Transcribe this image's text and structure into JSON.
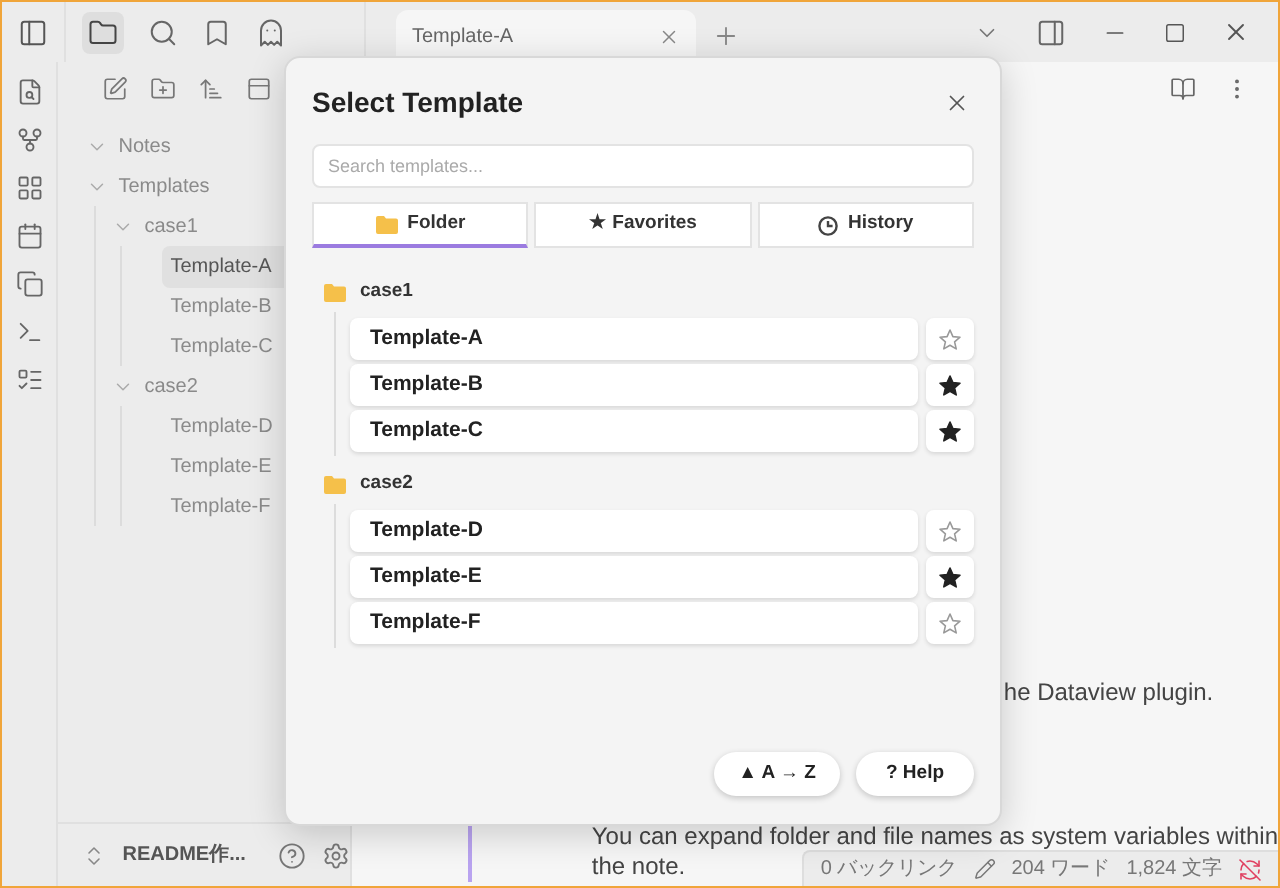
{
  "tab": {
    "title": "Template-A"
  },
  "sidebar": {
    "tree": [
      {
        "label": "Notes",
        "expanded": true,
        "selected": false
      },
      {
        "label": "Templates",
        "expanded": true,
        "selected": false,
        "children": [
          {
            "label": "case1",
            "expanded": true,
            "selected": false,
            "children": [
              {
                "label": "Template-A",
                "selected": true
              },
              {
                "label": "Template-B",
                "selected": false
              },
              {
                "label": "Template-C",
                "selected": false
              }
            ]
          },
          {
            "label": "case2",
            "expanded": true,
            "selected": false,
            "children": [
              {
                "label": "Template-D",
                "selected": false
              },
              {
                "label": "Template-E",
                "selected": false
              },
              {
                "label": "Template-F",
                "selected": false
              }
            ]
          }
        ]
      }
    ],
    "vault": "README作..."
  },
  "editor": {
    "partial_line": "he Dataview plugin.",
    "paragraph_lines": [
      "You can expand folder and file names as system variables within",
      "the note."
    ]
  },
  "status_bar": {
    "backlinks": "0 バックリンク",
    "words": "204 ワード",
    "chars": "1,824 文字"
  },
  "modal": {
    "title": "Select Template",
    "search": {
      "placeholder": "Search templates..."
    },
    "tabs": [
      {
        "label": "Folder",
        "selected": true
      },
      {
        "label": "★ Favorites",
        "selected": false
      },
      {
        "label": "History",
        "selected": false
      }
    ],
    "groups": [
      {
        "name": "case1",
        "templates": [
          {
            "name": "Template-A",
            "favorite": false
          },
          {
            "name": "Template-B",
            "favorite": true
          },
          {
            "name": "Template-C",
            "favorite": true
          }
        ]
      },
      {
        "name": "case2",
        "templates": [
          {
            "name": "Template-D",
            "favorite": false
          },
          {
            "name": "Template-E",
            "favorite": true
          },
          {
            "name": "Template-F",
            "favorite": false
          }
        ]
      }
    ],
    "buttons": [
      "▲ A → Z",
      "? Help"
    ]
  }
}
